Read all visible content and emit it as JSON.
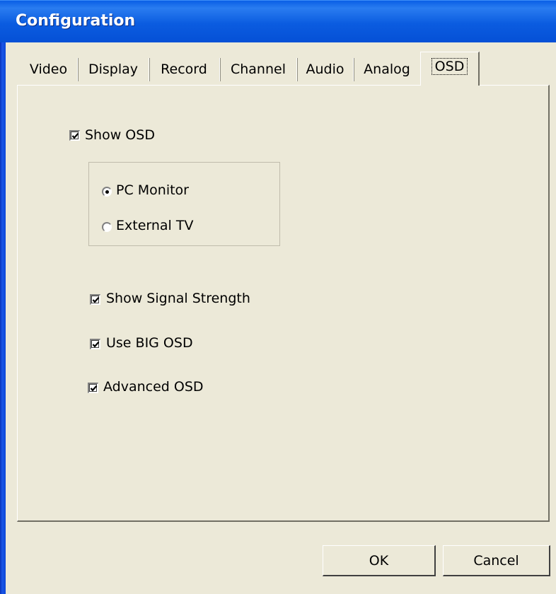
{
  "window": {
    "title": "Configuration"
  },
  "tabs": [
    {
      "label": "Video",
      "active": false
    },
    {
      "label": "Display",
      "active": false
    },
    {
      "label": "Record",
      "active": false
    },
    {
      "label": "Channel",
      "active": false
    },
    {
      "label": "Audio",
      "active": false
    },
    {
      "label": "Analog",
      "active": false
    },
    {
      "label": "OSD",
      "active": true
    }
  ],
  "osd": {
    "show_osd": {
      "label": "Show OSD",
      "checked": true
    },
    "output": {
      "options": [
        {
          "label": "PC Monitor",
          "selected": true
        },
        {
          "label": "External TV",
          "selected": false
        }
      ]
    },
    "show_signal_strength": {
      "label": "Show Signal Strength",
      "checked": true
    },
    "use_big_osd": {
      "label": "Use BIG OSD",
      "checked": true
    },
    "advanced_osd": {
      "label": "Advanced OSD",
      "checked": true
    }
  },
  "buttons": {
    "ok": "OK",
    "cancel": "Cancel"
  },
  "colors": {
    "titlebar": "#0b5ce0",
    "dialog_bg": "#ece9d8"
  }
}
